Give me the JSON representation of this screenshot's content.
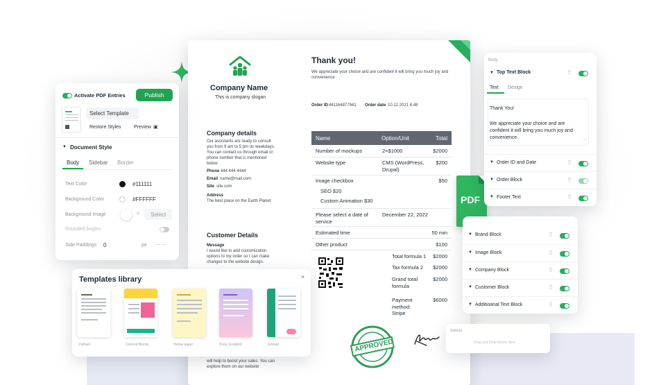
{
  "invoice": {
    "company_name": "Company Name",
    "slogan": "This is company slogan",
    "thank_you": "Thank you!",
    "thank_text": [
      "We appreciate your choice and are confident it will bring you much joy and",
      "convenience"
    ],
    "order_id_label": "Order ID",
    "order_id": "461164877941",
    "order_date_label": "Order date",
    "order_date": "10.12.2021 6:48",
    "company_details_title": "Company details",
    "company_details_text": [
      "Our assistants are ready to consult",
      "you from 9 am to 5 pm on weekdays.",
      "You can contact us through email or",
      "phone number that is mentioned",
      "below"
    ],
    "phone_label": "Phone",
    "phone": "444 444 4444",
    "email_label": "Email",
    "email": "name@mail.com",
    "site_label": "Site",
    "site": "site.com",
    "address_label": "Address",
    "address": "The best place on the Earth Planet",
    "customer_details_title": "Customer Details",
    "message_label": "Message",
    "message_text": [
      "I would like to add customization",
      "options to my order so I can make",
      "changes to the website design."
    ],
    "footer_text": [
      "will help to boost your sales. You can",
      "explore them on our website"
    ],
    "table": {
      "headers": [
        "Name",
        "Option/Unit",
        "Total"
      ],
      "rows": [
        {
          "name": "Number of mockups",
          "option": "2×$1000",
          "total": "$2000"
        },
        {
          "name": "Website type",
          "option": [
            "CMS (WordPress,",
            "Drupal)"
          ],
          "total": "$200"
        },
        {
          "name": "Image checkbox",
          "option": "",
          "total": "$50"
        },
        {
          "name": "SEO $20",
          "option": "",
          "total": ""
        },
        {
          "name": "Custom Animation $30",
          "option": "",
          "total": ""
        },
        {
          "name": [
            "Please select a date of",
            "service"
          ],
          "option": "December 22, 2022",
          "total": ""
        },
        {
          "name": "Estimated time",
          "option": "",
          "total": "50 min"
        },
        {
          "name": "Other product",
          "option": "",
          "total": "$100"
        }
      ],
      "summary": [
        {
          "label": "Total formula 1",
          "value": "$2000"
        },
        {
          "label": "Tax formula 2",
          "value": "$2000"
        },
        {
          "label": [
            "Grand total",
            "formula"
          ],
          "value": "$2000"
        },
        {
          "label": [
            "Payment",
            "method:",
            "Stripe"
          ],
          "value": "$6000"
        }
      ]
    },
    "stamp_text": "APPROVED"
  },
  "left_panel": {
    "activate_label": "Activate PDF Entries",
    "publish": "Publish",
    "select_template": "Select Template",
    "restore_styles": "Restore Styles",
    "preview": "Preview",
    "document_style": "Document Style",
    "tabs": [
      "Body",
      "Sidebar",
      "Border"
    ],
    "text_color_label": "Text Color",
    "text_color": "#111111",
    "background_color_label": "Background Color",
    "background_color": "#FFFFFF",
    "background_image_label": "Background Image",
    "select": "Select",
    "rounded_angles_label": "Rounded Angles",
    "side_paddings_label": "Side Paddings",
    "side_paddings_value": "0",
    "unit": "px"
  },
  "templates": {
    "title": "Templates library",
    "close": "×",
    "items": [
      "Default",
      "Colored Blocks",
      "Yellow paper",
      "Pinky Gradient",
      "Emrald"
    ],
    "colors": [
      "#ffffff",
      "#ffe066",
      "#fff6c8",
      "#e8d9f5",
      "#d6f0e6"
    ]
  },
  "right_panel": {
    "section": "Body",
    "top_text_block": "Top Text Block",
    "tabs": [
      "Text",
      "Design"
    ],
    "text_lines": [
      "Thank You!",
      "",
      "We appreciate your choice and are",
      "confident it will bring you much joy and",
      "convenience"
    ],
    "blocks": [
      "Order ID and Date",
      "Order Block",
      "Footer Text"
    ]
  },
  "right_panel2": {
    "blocks": [
      "Brand Block",
      "Image Block",
      "Company Block",
      "Customer Block",
      "Additioanal Text Block"
    ]
  },
  "dropzone": {
    "label": "Sidebar",
    "placeholder": "Drag and Drop blocks here"
  },
  "pdf_badge": "PDF",
  "colors": {
    "accent": "#22a352",
    "header_gray": "#606770"
  }
}
